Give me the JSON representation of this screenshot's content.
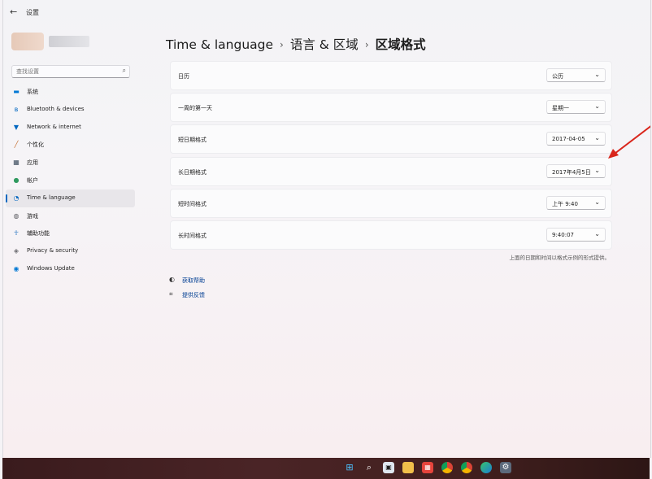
{
  "window": {
    "title": "设置",
    "back_glyph": "←"
  },
  "search": {
    "placeholder": "查找设置",
    "icon": "search-icon"
  },
  "sidebar": {
    "items": [
      {
        "label": "系统",
        "icon": "monitor-icon",
        "color": "#0078d4"
      },
      {
        "label": "Bluetooth & devices",
        "icon": "bluetooth-icon",
        "color": "#0067c0"
      },
      {
        "label": "Network & internet",
        "icon": "wifi-icon",
        "color": "#0067c0"
      },
      {
        "label": "个性化",
        "icon": "brush-icon",
        "color": "#c36b2a"
      },
      {
        "label": "应用",
        "icon": "apps-icon",
        "color": "#3a4a5c"
      },
      {
        "label": "帐户",
        "icon": "person-icon",
        "color": "#2f9a5f"
      },
      {
        "label": "Time & language",
        "icon": "globe-clock-icon",
        "color": "#0067c0",
        "active": true
      },
      {
        "label": "游戏",
        "icon": "gamepad-icon",
        "color": "#5a5a60"
      },
      {
        "label": "辅助功能",
        "icon": "accessibility-icon",
        "color": "#1f6fbf"
      },
      {
        "label": "Privacy & security",
        "icon": "shield-icon",
        "color": "#6b6b70"
      },
      {
        "label": "Windows Update",
        "icon": "update-icon",
        "color": "#0078d4"
      }
    ]
  },
  "breadcrumb": {
    "parts": [
      "Time & language",
      "语言 & 区域",
      "区域格式"
    ],
    "sep": "›"
  },
  "settings": [
    {
      "label": "日历",
      "value": "公历"
    },
    {
      "label": "一周的第一天",
      "value": "星期一"
    },
    {
      "label": "短日期格式",
      "value": "2017-04-05"
    },
    {
      "label": "长日期格式",
      "value": "2017年4月5日"
    },
    {
      "label": "短时间格式",
      "value": "上午 9:40"
    },
    {
      "label": "长时间格式",
      "value": "9:40:07"
    }
  ],
  "note": "上面的日期和时间以格式示例的形式提供。",
  "links": [
    {
      "label": "获取帮助",
      "icon": "help-icon"
    },
    {
      "label": "提供反馈",
      "icon": "feedback-icon"
    }
  ],
  "taskbar": {
    "icons": [
      "windows-start-icon",
      "search-icon",
      "task-view-icon",
      "file-explorer-icon",
      "store-icon",
      "chrome-icon",
      "chrome-icon",
      "edge-icon",
      "settings-icon"
    ]
  },
  "colors": {
    "accent": "#0067c0",
    "annotation_arrow": "#d9261c",
    "link": "#003e92"
  }
}
